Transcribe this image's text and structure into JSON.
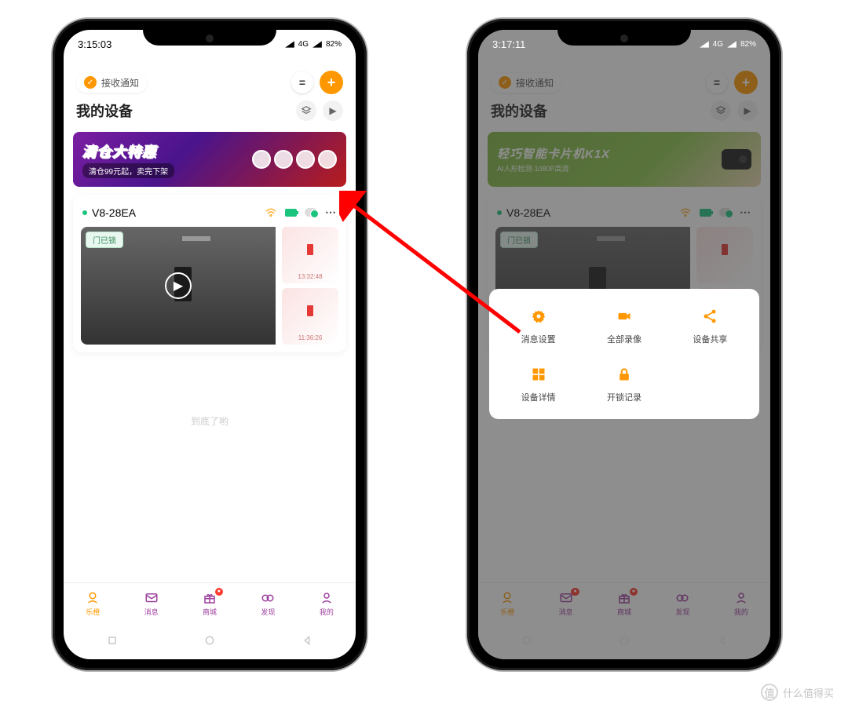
{
  "left": {
    "status_time": "3:15:03",
    "status_net": "4G",
    "status_batt": "82%"
  },
  "right": {
    "status_time": "3:17:11",
    "status_net": "4G",
    "status_batt": "82%"
  },
  "header": {
    "notify_pill": "接收通知"
  },
  "page_title": "我的设备",
  "banner_left": {
    "title": "清仓大特惠",
    "sub": "清仓99元起，卖完下架"
  },
  "banner_right": {
    "title": "轻巧智能卡片机K1X",
    "sub": "AI人形检测·1080P高清"
  },
  "device": {
    "name": "V8-28EA",
    "lock_tag": "门已锁",
    "thumb_time_1": "13:32:48",
    "thumb_time_2": "11:36:26"
  },
  "end_text": "到底了哟",
  "nav": {
    "0": "乐橙",
    "1": "消息",
    "2": "商城",
    "3": "发现",
    "4": "我的"
  },
  "menu": {
    "0": "消息设置",
    "1": "全部录像",
    "2": "设备共享",
    "3": "设备详情",
    "4": "开锁记录"
  },
  "watermark": "什么值得买"
}
